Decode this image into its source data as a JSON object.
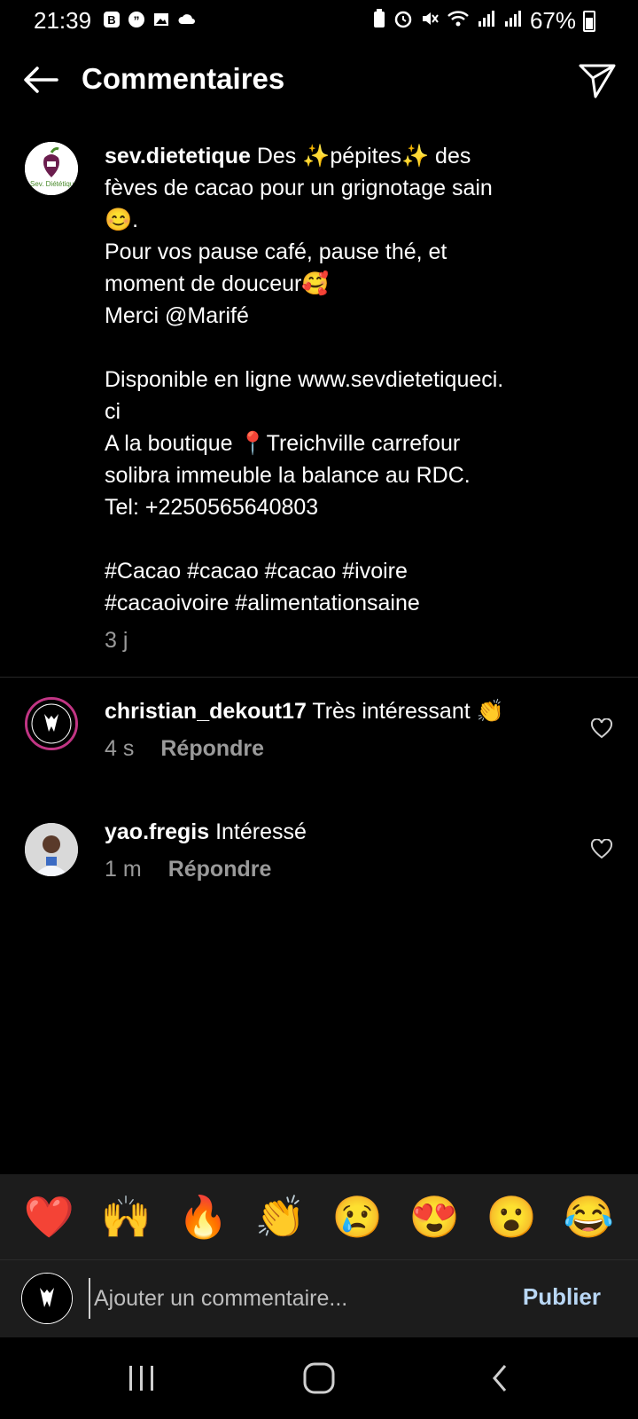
{
  "status_bar": {
    "time": "21:39",
    "battery": "67%",
    "battery_level": 0.67,
    "icons_left": [
      "b-icon",
      "quote-icon",
      "gallery-icon",
      "cloud-icon"
    ],
    "icons_right": [
      "battery-saver-icon",
      "alarm-icon",
      "mute-icon",
      "wifi-icon",
      "signal-icon",
      "signal-icon"
    ]
  },
  "header": {
    "title": "Commentaires"
  },
  "caption": {
    "username": "sev.dietetique",
    "lines": [
      "Des ✨pépites✨ des",
      "fèves de cacao pour un grignotage sain",
      "😊.",
      "Pour vos pause café, pause thé, et",
      "moment de douceur🥰",
      "Merci @Marifé",
      "",
      "Disponible en ligne www.sevdietetiqueci.",
      "ci",
      "A la boutique 📍Treichville carrefour",
      "solibra immeuble la balance au RDC.",
      "Tel: +2250565640803",
      "",
      "#Cacao #cacao #cacao #ivoire",
      "#cacaoivoire #alimentationsaine"
    ],
    "time": "3 j"
  },
  "comments": [
    {
      "username": "christian_dekout17",
      "text": "Très intéressant 👏",
      "time": "4 s",
      "reply": "Répondre"
    },
    {
      "username": "yao.fregis",
      "text": "Intéressé",
      "time": "1 m",
      "reply": "Répondre"
    }
  ],
  "reactions": [
    "❤️",
    "🙌",
    "🔥",
    "👏",
    "😢",
    "😍",
    "😮",
    "😂"
  ],
  "input": {
    "placeholder": "Ajouter un commentaire...",
    "publish": "Publier"
  },
  "colors": {
    "background": "#000000",
    "muted": "#9a9a9a",
    "publish": "#b9d7f5",
    "bar": "#1c1c1c"
  }
}
